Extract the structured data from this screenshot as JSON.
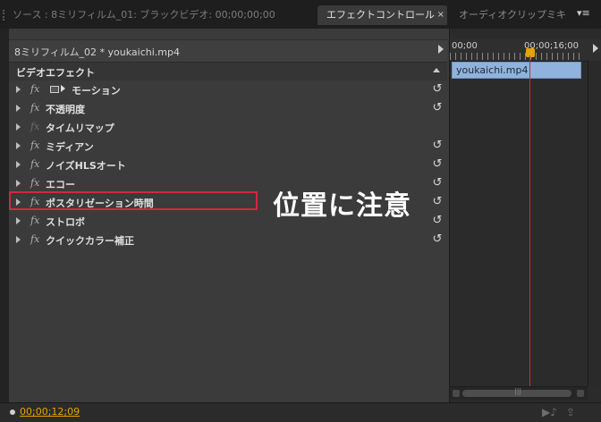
{
  "tabs": {
    "source": "ソース : 8ミリフィルム_01: ブラックビデオ: 00;00;00;00",
    "effect_controls": "エフェクトコントロール",
    "effect_close": "×",
    "audio_mixer": "オーディオクリップミキ",
    "panel_menu": "▾≡"
  },
  "clip_bar": {
    "name": "8ミリフィルム_02 * youkaichi.mp4"
  },
  "section": {
    "title": "ビデオエフェクト"
  },
  "effects": [
    {
      "fx": "fx",
      "label": "モーション",
      "reset": "↺"
    },
    {
      "fx": "fx",
      "label": "不透明度",
      "reset": "↺"
    },
    {
      "fx": "fx",
      "label": "タイムリマップ",
      "reset": ""
    },
    {
      "fx": "fx",
      "label": "ミディアン",
      "reset": "↺"
    },
    {
      "fx": "fx",
      "label": "ノイズHLSオート",
      "reset": "↺"
    },
    {
      "fx": "fx",
      "label": "エコー",
      "reset": "↺"
    },
    {
      "fx": "fx",
      "label": "ポスタリゼーション時間",
      "reset": "↺"
    },
    {
      "fx": "fx",
      "label": "ストロボ",
      "reset": "↺"
    },
    {
      "fx": "fx",
      "label": "クイックカラー補正",
      "reset": "↺"
    }
  ],
  "annotation": "位置に注意",
  "timeline": {
    "start_tc": "00;00",
    "end_tc": "00;00;16;00",
    "clip_label": "youkaichi.mp4",
    "scroll_grip": "|||"
  },
  "footer": {
    "timecode": "00;00;12;09",
    "btn_play_audio": "▶♪",
    "btn_export": "⇪"
  },
  "colors": {
    "accent_timecode": "#e5a400",
    "playhead": "#d7263d",
    "clip": "#8fb3dc",
    "highlight": "#d7263d"
  }
}
